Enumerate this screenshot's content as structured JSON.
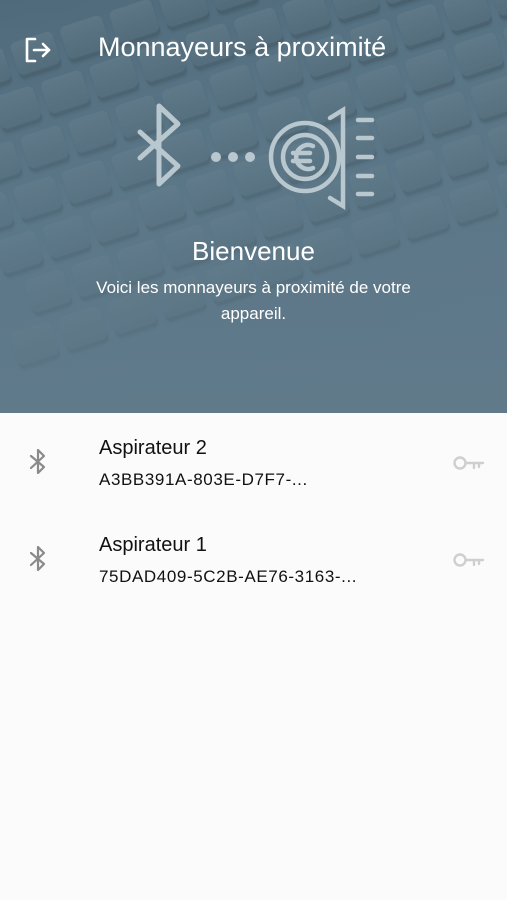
{
  "header": {
    "title": "Monnayeurs à proximité",
    "exit_icon": "logout-icon"
  },
  "hero": {
    "welcome": "Bienvenue",
    "subtitle": "Voici les monnayeurs à proximité de votre appareil.",
    "illustration_icons": [
      "bluetooth-icon",
      "dots-icon",
      "euro-coin-machine-icon"
    ]
  },
  "devices": [
    {
      "name": "Aspirateur 2",
      "id": "A3BB391A-803E-D7F7-...",
      "icon": "bluetooth-icon",
      "action_icon": "key-icon"
    },
    {
      "name": "Aspirateur 1",
      "id": "75DAD409-5C2B-AE76-3163-...",
      "icon": "bluetooth-icon",
      "action_icon": "key-icon"
    }
  ],
  "colors": {
    "hero_bg": "#5a788a",
    "list_bg": "#fbfbfb",
    "icon_gray": "#8a8a8a",
    "key_gray": "#cfcfcf"
  }
}
